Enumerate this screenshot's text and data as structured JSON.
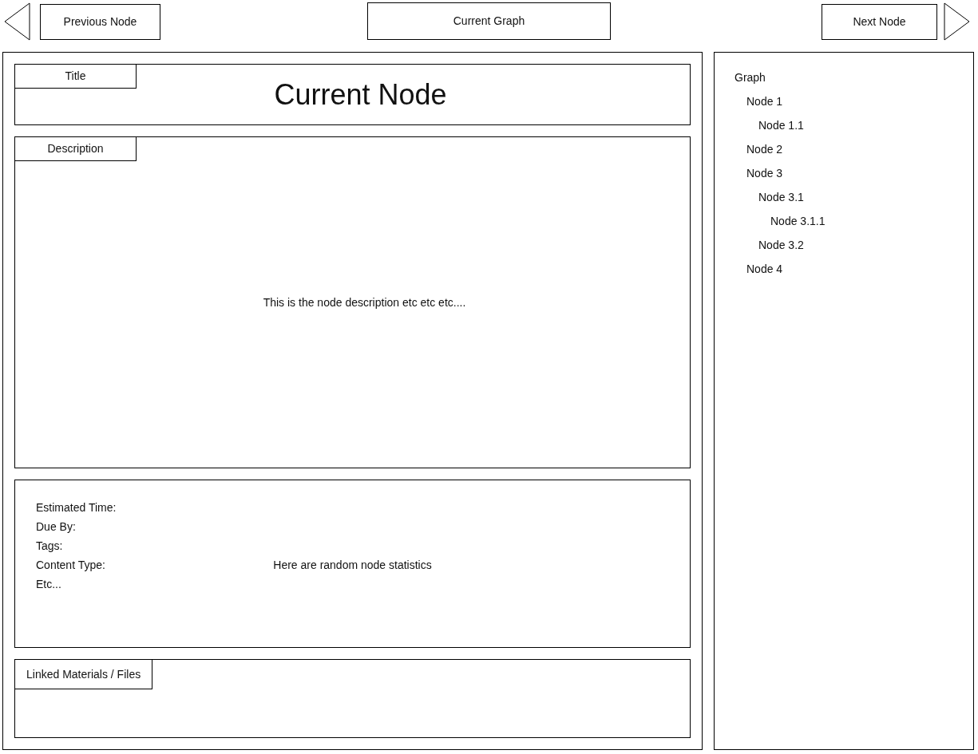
{
  "nav": {
    "previous_button": "Previous Node",
    "current_graph_button": "Current Graph",
    "next_button": "Next Node"
  },
  "title_panel": {
    "label": "Title",
    "value": "Current Node"
  },
  "description_panel": {
    "label": "Description",
    "text": "This is the node description etc etc etc...."
  },
  "statistics_panel": {
    "fields": [
      "Estimated Time:",
      "Due By:",
      "Tags:",
      "Content Type:",
      "Etc..."
    ],
    "note": "Here are random node statistics"
  },
  "materials_panel": {
    "label": "Linked Materials / Files"
  },
  "tree": {
    "label": "Graph",
    "children": [
      {
        "label": "Node 1",
        "children": [
          {
            "label": "Node 1.1"
          }
        ]
      },
      {
        "label": "Node 2"
      },
      {
        "label": "Node 3",
        "children": [
          {
            "label": "Node 3.1",
            "children": [
              {
                "label": "Node 3.1.1"
              }
            ]
          },
          {
            "label": "Node 3.2"
          }
        ]
      },
      {
        "label": "Node 4"
      }
    ]
  }
}
